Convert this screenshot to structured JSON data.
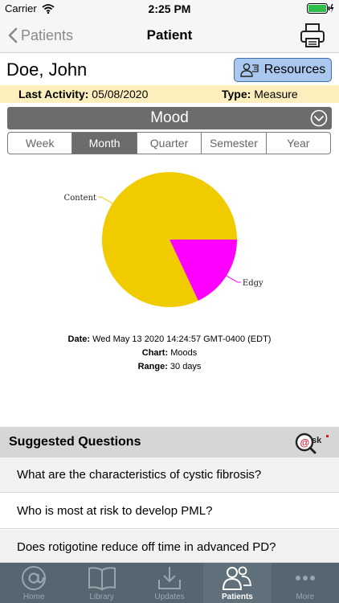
{
  "status": {
    "carrier": "Carrier",
    "time": "2:25 PM"
  },
  "nav": {
    "back_label": "Patients",
    "title": "Patient"
  },
  "patient": {
    "name": "Doe, John",
    "resources_label": "Resources",
    "last_activity_label": "Last Activity:",
    "last_activity_value": "05/08/2020",
    "type_label": "Type:",
    "type_value": "Measure"
  },
  "mood": {
    "title": "Mood",
    "periods": [
      "Week",
      "Month",
      "Quarter",
      "Semester",
      "Year"
    ],
    "selected_period": "Month"
  },
  "chart_data": {
    "type": "pie",
    "categories": [
      "Content",
      "Edgy"
    ],
    "values": [
      82,
      18
    ],
    "colors": [
      "#efcb00",
      "#ff00ff"
    ],
    "legend": "none"
  },
  "chart_info": {
    "date_label": "Date:",
    "date_value": "Wed May 13 2020 14:24:57 GMT-0400 (EDT)",
    "chart_label": "Chart:",
    "chart_value": "Moods",
    "range_label": "Range:",
    "range_value": "30 days"
  },
  "suggested": {
    "title": "Suggested Questions",
    "questions": [
      "What are the characteristics of cystic fibrosis?",
      "Who is most at risk to develop PML?",
      "Does rotigotine reduce off time in advanced PD?"
    ]
  },
  "tabs": [
    {
      "label": "Home",
      "icon": "at-sign-icon"
    },
    {
      "label": "Library",
      "icon": "book-icon"
    },
    {
      "label": "Updates",
      "icon": "download-icon"
    },
    {
      "label": "Patients",
      "icon": "people-icon",
      "active": true
    },
    {
      "label": "More",
      "icon": "ellipsis-icon"
    }
  ],
  "colors": {
    "accent_button": "#a9c7ef",
    "activity_bar": "#fcefbd",
    "tabbar": "#566670"
  }
}
